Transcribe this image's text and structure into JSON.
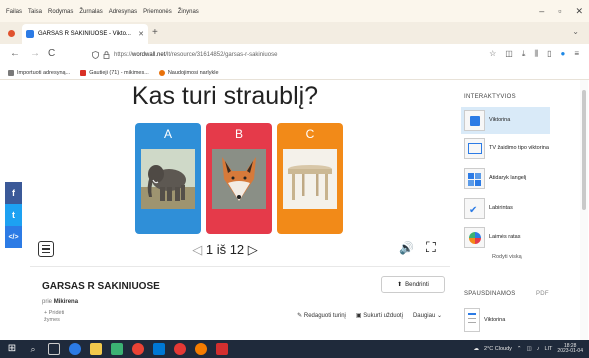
{
  "menubar": {
    "items": [
      "Failas",
      "Taisa",
      "Rodymas",
      "Žurnalas",
      "Adresynas",
      "Priemonės",
      "Žinynas"
    ],
    "minimize": "–",
    "maximize": "▫",
    "close": "✕"
  },
  "tabs": [
    {
      "label": "GARSAS R SAKINIUOSE - Vikto...",
      "close": "✕"
    }
  ],
  "newtab": "+",
  "tabs_chevron": "⌄",
  "navbar": {
    "back": "←",
    "forward": "→",
    "reload": "C",
    "url_prefix": "https://",
    "url_domain": "wordwall.net",
    "url_rest": "/lt/resource/31614852/garsas-r-sakiniuose"
  },
  "bookmarks": [
    {
      "label": "Importuoti adresyną...",
      "color": "#7a7a7a"
    },
    {
      "label": "Gautieji (71) - mikimes...",
      "color": "#d93025"
    },
    {
      "label": "Naudojimosi narlykle",
      "color": "#e8710a"
    }
  ],
  "social": {
    "facebook": "f",
    "twitter": "t",
    "embed": "</>"
  },
  "question": "Kas turi straublį?",
  "answers": [
    {
      "letter": "A",
      "image": "elephant",
      "color": "#2f8fd8"
    },
    {
      "letter": "B",
      "image": "fox",
      "color": "#e53a4a"
    },
    {
      "letter": "C",
      "image": "table",
      "color": "#f28a18"
    }
  ],
  "pager": {
    "current": "1",
    "separator": "iš",
    "total": "12",
    "prev": "◁",
    "next": "▷"
  },
  "controls": {
    "sound_icon": "🔊",
    "fullscreen_icon": "⛶"
  },
  "worksheet": {
    "title": "GARSAS R SAKINIUOSE",
    "share_label": "Bendrinti",
    "author_prefix": "prie",
    "author": "Mikirena",
    "tags_add": "Pridėti",
    "tags_label": "žymes",
    "edit_label": "Redaguoti turinį",
    "create_task_label": "Sukurti užduotį",
    "more_label": "Daugiau"
  },
  "right_panel": {
    "header": "INTERAKTYVIOS",
    "items": [
      {
        "label": "Viktorina",
        "selected": true
      },
      {
        "label": "TV žaidimo tipo viktorina",
        "selected": false
      },
      {
        "label": "Atidaryk langelį",
        "selected": false
      },
      {
        "label": "Labirintas",
        "selected": false
      },
      {
        "label": "Laimės ratas",
        "selected": false
      }
    ],
    "show_all": "Rodyti viską",
    "printable_header": "SPAUSDINAMOS",
    "pdf_label": "PDF",
    "printable_items": [
      {
        "label": "Viktorina"
      }
    ]
  },
  "taskbar": {
    "weather": "2°C Cloudy",
    "lang": "LIT",
    "time": "18:28",
    "date": "2023-01-04"
  }
}
